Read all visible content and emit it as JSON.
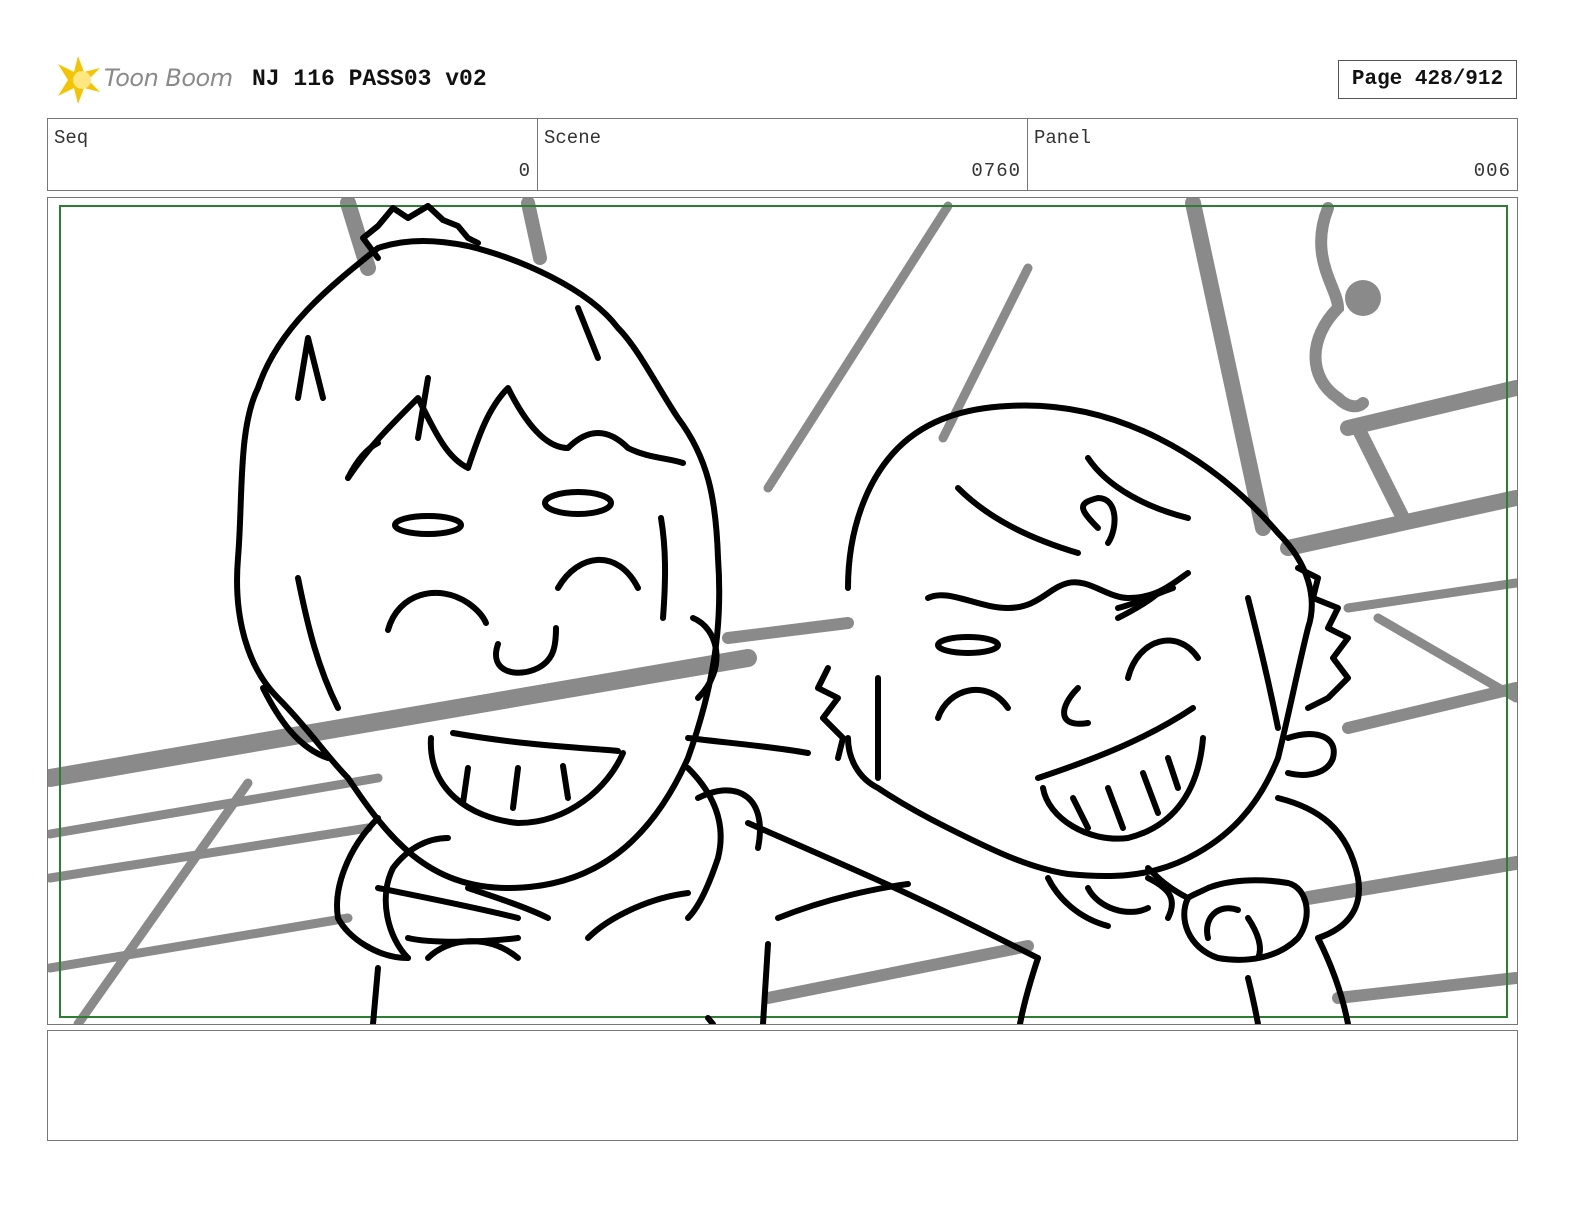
{
  "header": {
    "logo_text": "Toon Boom",
    "title": "NJ 116 PASS03 v02",
    "page_label": "Page 428/912"
  },
  "info": {
    "seq_label": "Seq",
    "seq_value": "0",
    "scene_label": "Scene",
    "scene_value": "0760",
    "panel_label": "Panel",
    "panel_value": "006"
  },
  "notes": {
    "text": ""
  },
  "colors": {
    "safe_frame": "#2e7d32",
    "background_lines": "#8a8a8a",
    "ink": "#000000",
    "logo_star": "#f5c400"
  }
}
